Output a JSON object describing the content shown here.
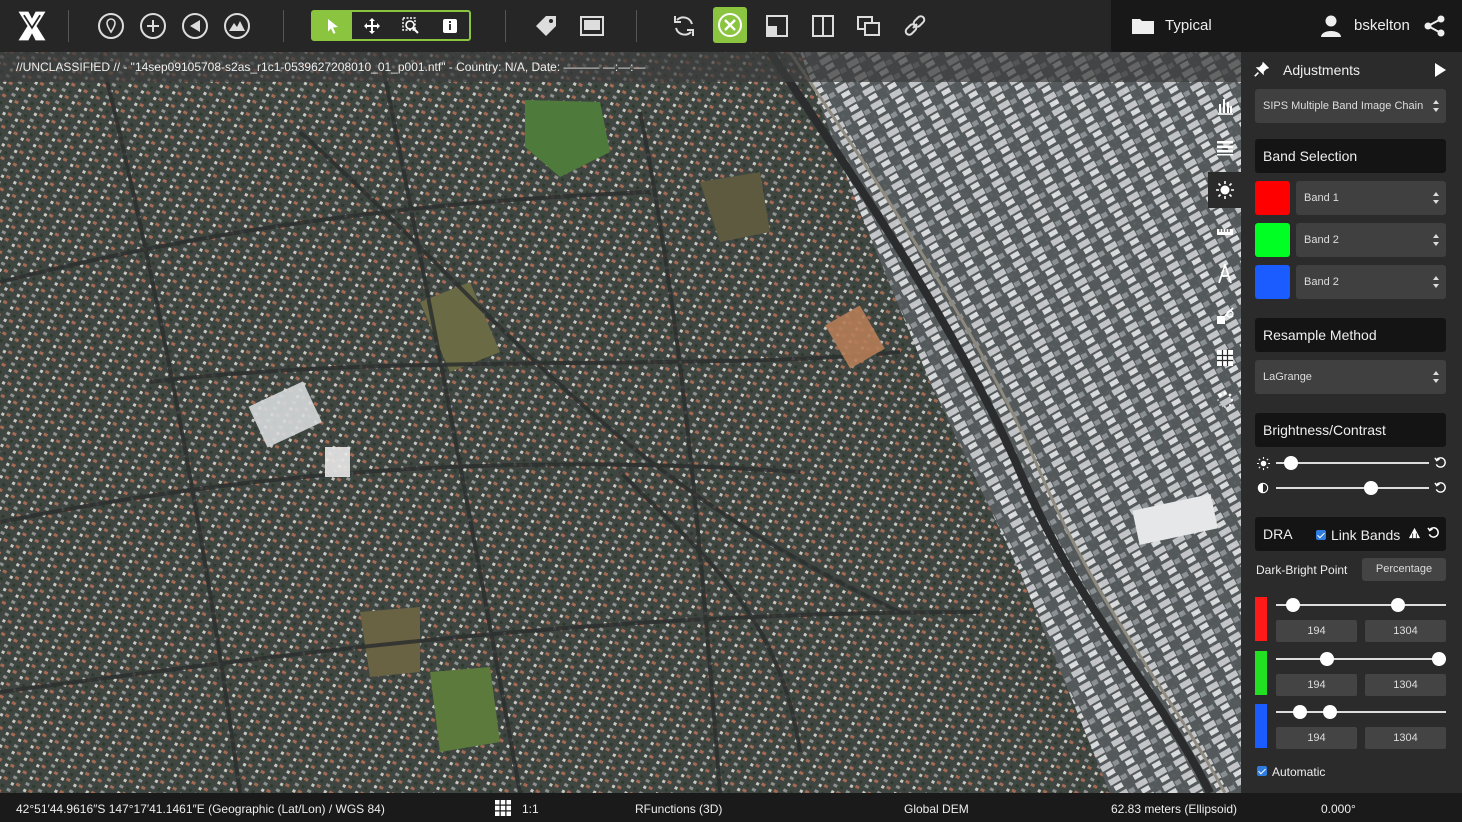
{
  "header": {
    "folder_label": "Typical",
    "username": "bskelton"
  },
  "image_title": "//UNCLASSIFIED // - \"14sep09105708-s2as_r1c1-0539627208010_01_p001.ntf\" - Country: N/A, Date: ——— —:—:—",
  "panel": {
    "title": "Adjustments",
    "chain_select": "SIPS Multiple Band Image Chain",
    "band_selection": {
      "header": "Band Selection",
      "bands": [
        {
          "color": "#ff0000",
          "value": "Band 1"
        },
        {
          "color": "#00ff22",
          "value": "Band 2"
        },
        {
          "color": "#1a5cff",
          "value": "Band 2"
        }
      ]
    },
    "resample": {
      "header": "Resample Method",
      "value": "LaGrange"
    },
    "brightness_contrast": {
      "header": "Brightness/Contrast",
      "brightness": 0.1,
      "contrast": 0.62
    },
    "dra": {
      "label": "DRA",
      "link_bands_label": "Link Bands",
      "dark_bright_label": "Dark-Bright Point",
      "mode_button": "Percentage",
      "channels": [
        {
          "color": "#ff1a1a",
          "low": "194",
          "high": "1304",
          "low_pos": 0.1,
          "high_pos": 0.72
        },
        {
          "color": "#22e022",
          "low": "194",
          "high": "1304",
          "low_pos": 0.3,
          "high_pos": 0.99
        },
        {
          "color": "#1a5cff",
          "low": "194",
          "high": "1304",
          "low_pos": 0.14,
          "high_pos": 0.32
        }
      ],
      "automatic_label": "Automatic"
    }
  },
  "status": {
    "coordinates": "42°51′44.9616″S 147°17′41.1461″E (Geographic (Lat/Lon) / WGS 84)",
    "scale": "1:1",
    "projection": "RFunctions (3D)",
    "elevation": "Global DEM",
    "gsd": "62.83 meters (Ellipsoid)",
    "rotation": "0.000°"
  },
  "colors": {
    "accent": "#8bc540"
  }
}
